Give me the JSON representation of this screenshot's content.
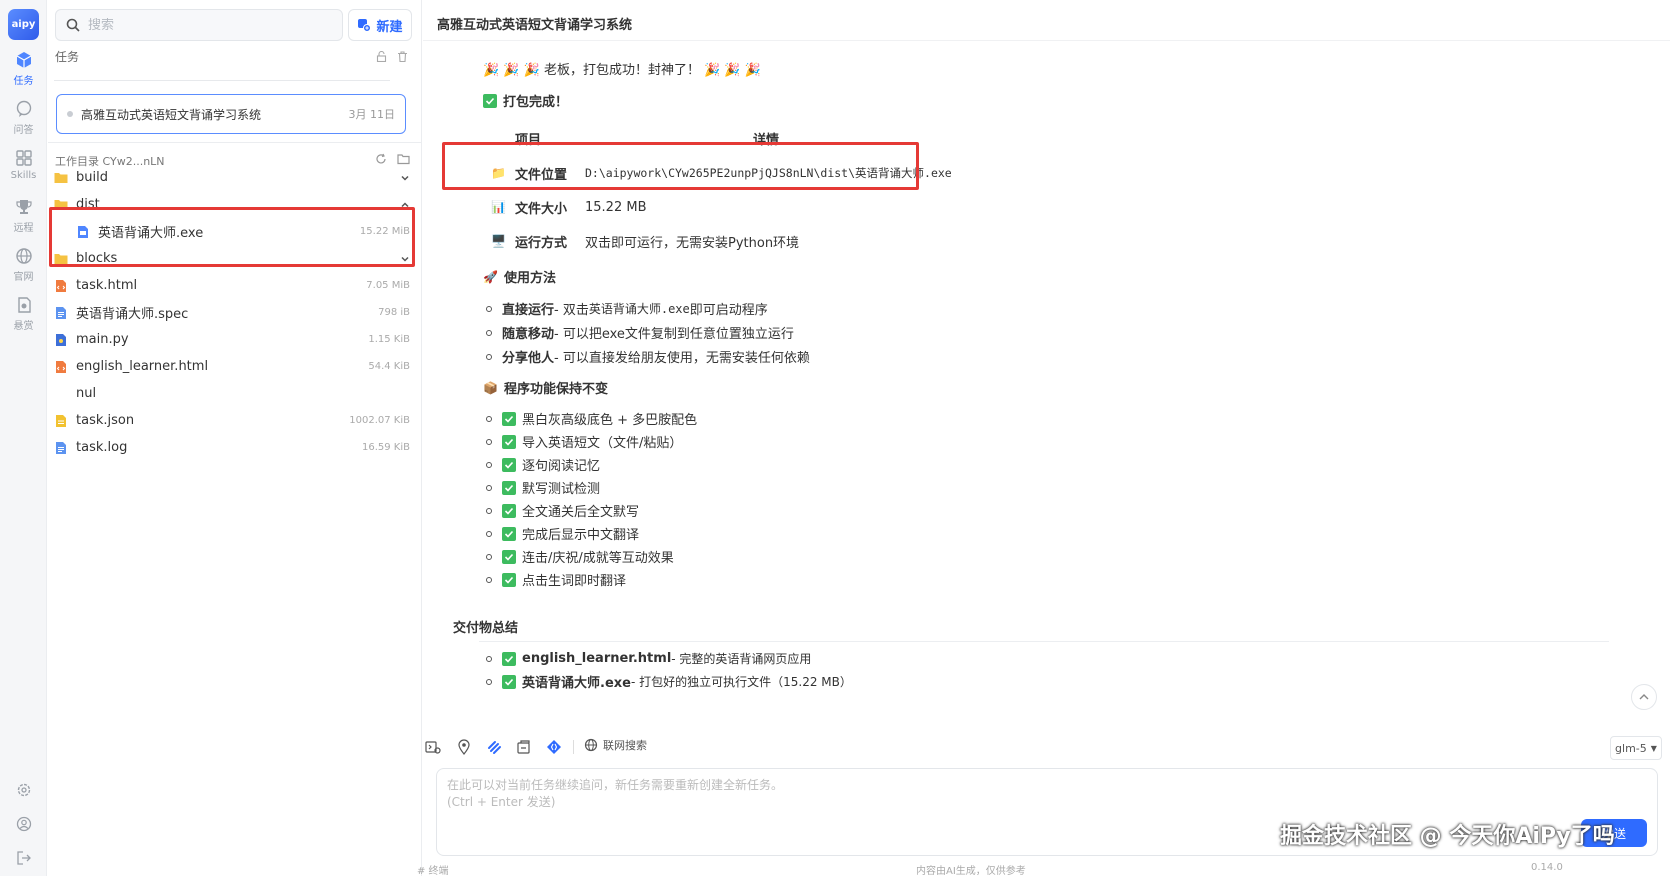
{
  "rail": {
    "logo": "aipy",
    "items": [
      {
        "label": "任务",
        "icon": "cube-icon"
      },
      {
        "label": "问答",
        "icon": "chat-icon"
      },
      {
        "label": "Skills",
        "icon": "grid-icon"
      },
      {
        "label": "远程",
        "icon": "trophy-icon"
      },
      {
        "label": "官网",
        "icon": "globe-icon"
      },
      {
        "label": "悬赏",
        "icon": "bounty-icon"
      }
    ]
  },
  "side": {
    "search_placeholder": "搜索",
    "new_label": "新建",
    "tasks_title": "任务",
    "task": {
      "title": "高雅互动式英语短文背诵学习系统",
      "date": "3月 11日"
    },
    "workdir_label": "工作目录 CYw2...nLN",
    "files": [
      {
        "name": "build",
        "type": "folder",
        "size": "",
        "expand": "down"
      },
      {
        "name": "dist",
        "type": "folder",
        "size": "",
        "expand": "up"
      },
      {
        "name": "英语背诵大师.exe",
        "type": "exe",
        "size": "15.22 MiB",
        "expand": ""
      },
      {
        "name": "blocks",
        "type": "folder",
        "size": "",
        "expand": "down"
      },
      {
        "name": "task.html",
        "type": "html",
        "size": "7.05 MiB",
        "expand": ""
      },
      {
        "name": "英语背诵大师.spec",
        "type": "doc",
        "size": "798 iB",
        "expand": ""
      },
      {
        "name": "main.py",
        "type": "py",
        "size": "1.15 KiB",
        "expand": ""
      },
      {
        "name": "english_learner.html",
        "type": "html",
        "size": "54.4 KiB",
        "expand": ""
      },
      {
        "name": "nul",
        "type": "none",
        "size": "",
        "expand": ""
      },
      {
        "name": "task.json",
        "type": "json",
        "size": "1002.07 KiB",
        "expand": ""
      },
      {
        "name": "task.log",
        "type": "doc",
        "size": "16.59 KiB",
        "expand": ""
      }
    ]
  },
  "main": {
    "title": "高雅互动式英语短文背诵学习系统",
    "congrats": "🎉 🎉 🎉  老板，打包成功！封神了！ 🎉 🎉 🎉",
    "done": "打包完成！",
    "table": {
      "head": [
        "项目",
        "详情"
      ],
      "rows": [
        {
          "icon": "📁",
          "key": "文件位置",
          "val": "D:\\aipywork\\CYw265PE2unpPjQJS8nLN\\dist\\英语背诵大师.exe"
        },
        {
          "icon": "📊",
          "key": "文件大小",
          "val": "15.22 MB"
        },
        {
          "icon": "🖥️",
          "key": "运行方式",
          "val": "双击即可运行，无需安装Python环境"
        }
      ]
    },
    "usage_title": "使用方法",
    "usage": [
      {
        "b": "直接运行",
        "pre": " - 双击 ",
        "code": "英语背诵大师.exe",
        "post": " 即可启动程序"
      },
      {
        "b": "随意移动",
        "pre": " - 可以把exe文件复制到任意位置独立运行",
        "code": "",
        "post": ""
      },
      {
        "b": "分享他人",
        "pre": " - 可以直接发给朋友使用，无需安装任何依赖",
        "code": "",
        "post": ""
      }
    ],
    "features_title": "程序功能保持不变",
    "features": [
      "黑白灰高级底色 + 多巴胺配色",
      "导入英语短文（文件/粘贴）",
      "逐句阅读记忆",
      "默写测试检测",
      "全文通关后全文默写",
      "完成后显示中文翻译",
      "连击/庆祝/成就等互动效果",
      "点击生词即时翻译"
    ],
    "summary_title": "交付物总结",
    "summary": [
      {
        "b": "english_learner.html",
        "t": " - 完整的英语背诵网页应用"
      },
      {
        "b": "英语背诵大师.exe",
        "t": " - 打包好的独立可执行文件（15.22 MB）"
      }
    ]
  },
  "composer": {
    "web_search": "联网搜索",
    "model": "glm-5",
    "placeholder": "在此可以对当前任务继续追问，新任务需要重新创建全新任务。\n(Ctrl + Enter 发送)",
    "send": "发送",
    "foot_left": "# 终端",
    "foot_mid": "内容由AI生成，仅供参考",
    "version": "0.14.0"
  },
  "watermark": "掘金技术社区 @ 今天你AiPy了吗"
}
